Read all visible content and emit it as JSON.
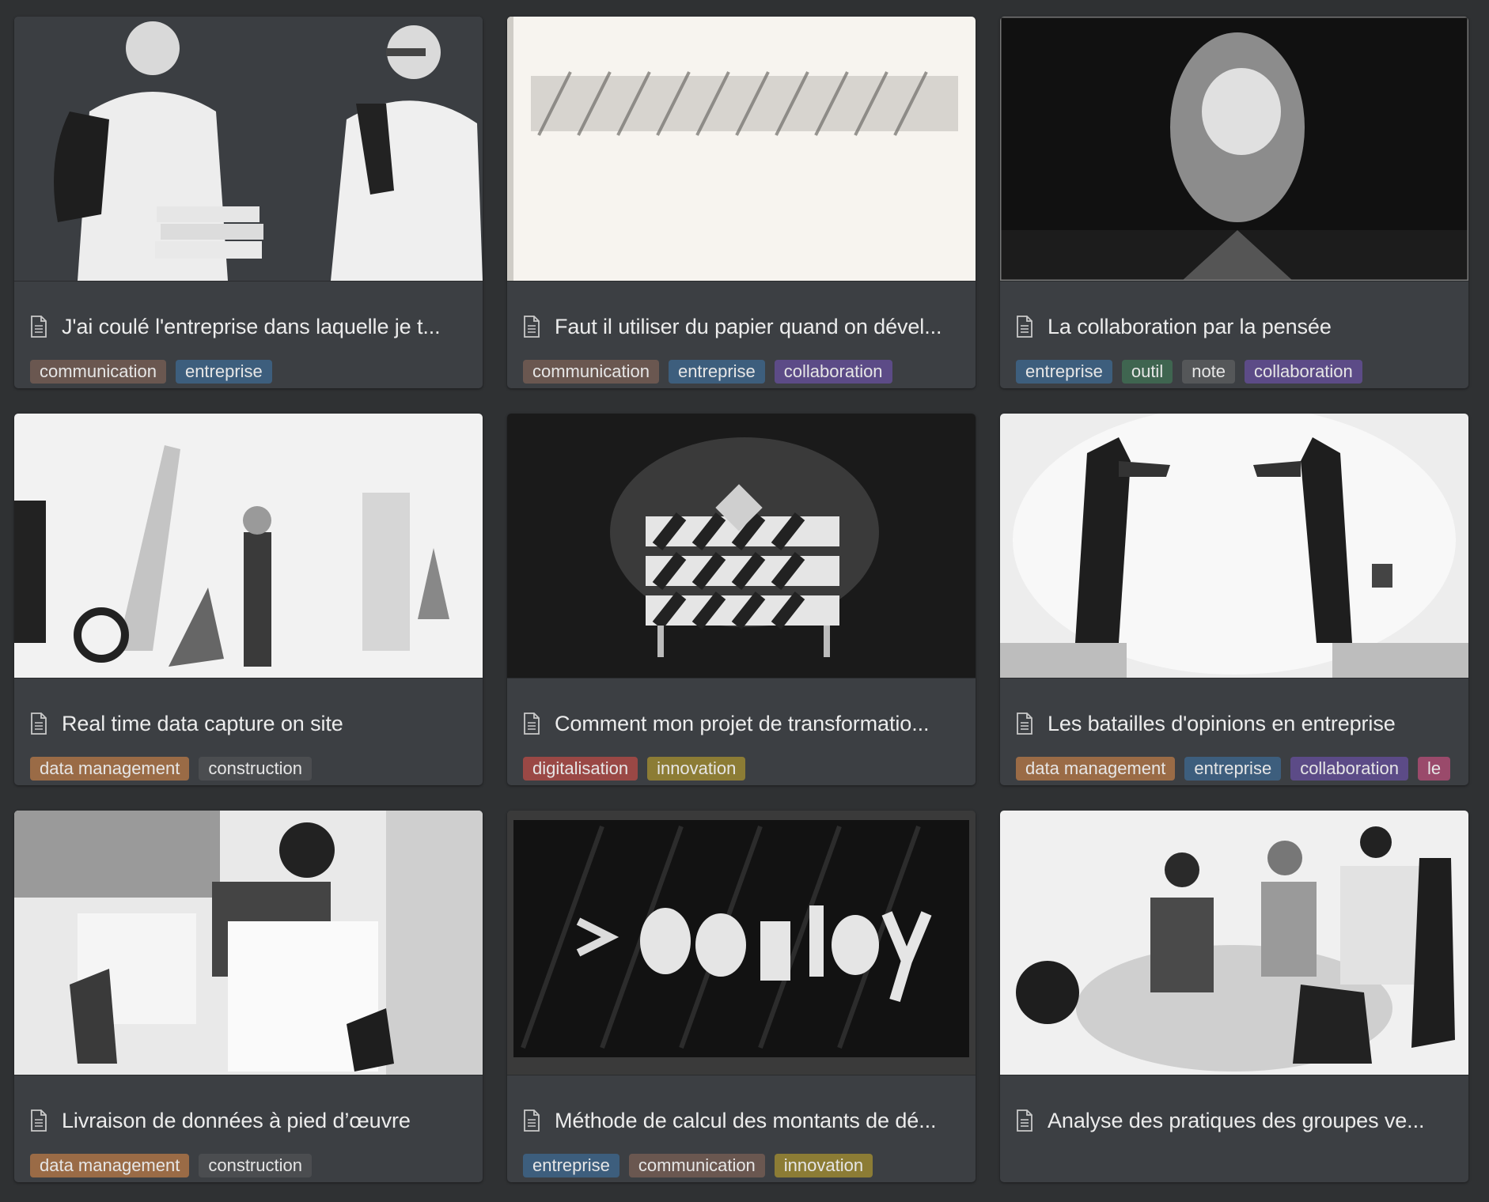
{
  "tag_colors": {
    "communication": "#6a5750",
    "entreprise": "#3d5e7d",
    "collaboration": "#5c4b87",
    "outil": "#3f6550",
    "note": "#555759",
    "data management": "#9a6b46",
    "construction": "#4b4d50",
    "digitalisation": "#9a4845",
    "innovation": "#8c7c35",
    "le": "#9a4a6b"
  },
  "icons": {
    "page": "document-icon"
  },
  "cards": [
    {
      "title": "J'ai coulé l'entreprise dans laquelle je t...",
      "tags": [
        "communication",
        "entreprise"
      ]
    },
    {
      "title": "Faut il utiliser du papier quand on dével...",
      "tags": [
        "communication",
        "entreprise",
        "collaboration"
      ]
    },
    {
      "title": "La collaboration par la pensée",
      "tags": [
        "entreprise",
        "outil",
        "note",
        "collaboration"
      ]
    },
    {
      "title": "Real time data capture on site",
      "tags": [
        "data management",
        "construction"
      ]
    },
    {
      "title": "Comment mon projet de transformatio...",
      "tags": [
        "digitalisation",
        "innovation"
      ]
    },
    {
      "title": "Les batailles d'opinions en entreprise",
      "tags": [
        "data management",
        "entreprise",
        "collaboration",
        "le"
      ]
    },
    {
      "title": "Livraison de données à pied d’œuvre",
      "tags": [
        "data management",
        "construction"
      ]
    },
    {
      "title": "Méthode de calcul des montants de dé...",
      "tags": [
        "entreprise",
        "communication",
        "innovation"
      ]
    },
    {
      "title": "Analyse des pratiques des groupes ve...",
      "tags": []
    }
  ]
}
